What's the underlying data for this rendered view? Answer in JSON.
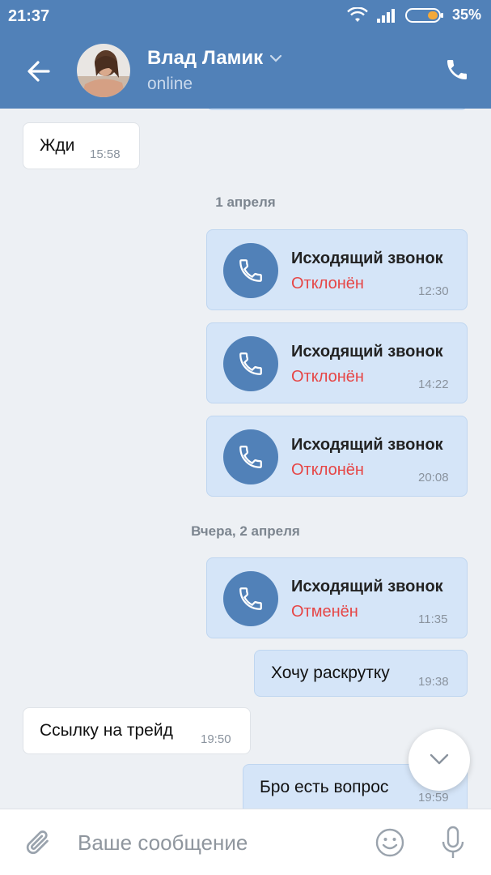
{
  "status_bar": {
    "time": "21:37",
    "battery": "35%"
  },
  "header": {
    "name": "Влад Ламик",
    "presence": "online"
  },
  "messages": [
    {
      "text": "Жди",
      "time": "15:58"
    },
    {
      "date": "1 апреля"
    },
    {
      "title": "Исходящий звонок",
      "status": "Отклонён",
      "time": "12:30"
    },
    {
      "title": "Исходящий звонок",
      "status": "Отклонён",
      "time": "14:22"
    },
    {
      "title": "Исходящий звонок",
      "status": "Отклонён",
      "time": "20:08"
    },
    {
      "date": "Вчера, 2 апреля"
    },
    {
      "title": "Исходящий звонок",
      "status": "Отменён",
      "time": "11:35"
    },
    {
      "text": "Хочу раскрутку",
      "time": "19:38"
    },
    {
      "text": "Ссылку на трейд",
      "time": "19:50"
    },
    {
      "text": "Бро есть вопрос",
      "time": "19:59"
    }
  ],
  "composer": {
    "placeholder": "Ваше сообщение"
  },
  "colors": {
    "header": "#5181b8",
    "declined": "#e64646",
    "outgoing_bubble": "#d5e5f8"
  },
  "icons": [
    "back-arrow-icon",
    "chevron-down-icon",
    "phone-icon",
    "wifi-icon",
    "signal-icon",
    "battery-icon",
    "paperclip-icon",
    "emoji-icon",
    "microphone-icon"
  ]
}
